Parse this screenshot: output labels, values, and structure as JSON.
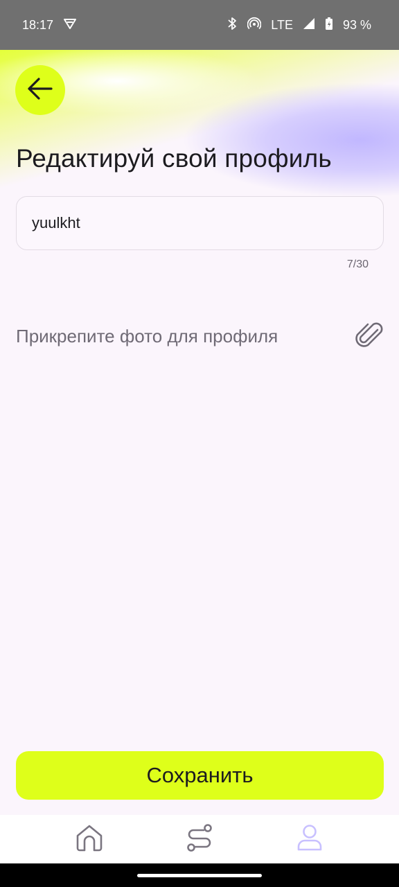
{
  "status_bar": {
    "time": "18:17",
    "network": "LTE",
    "battery": "93 %",
    "icons": [
      "vpn-shield-icon",
      "bluetooth-icon",
      "hotspot-icon",
      "signal-icon",
      "battery-charging-icon"
    ]
  },
  "header": {
    "back_icon": "arrow-left-icon",
    "title": "Редактируй свой профиль"
  },
  "form": {
    "name_value": "yuulkht",
    "char_counter": "7/30",
    "attach_label": "Прикрепите фото для профиля",
    "attach_icon": "paperclip-icon"
  },
  "actions": {
    "save_label": "Сохранить"
  },
  "bottom_nav": {
    "items": [
      {
        "icon": "home-icon",
        "active": false
      },
      {
        "icon": "route-icon",
        "active": false
      },
      {
        "icon": "profile-icon",
        "active": true
      }
    ]
  },
  "colors": {
    "accent": "#deff1a",
    "lavender": "#bdb4ff",
    "background": "#fbf5fc"
  }
}
